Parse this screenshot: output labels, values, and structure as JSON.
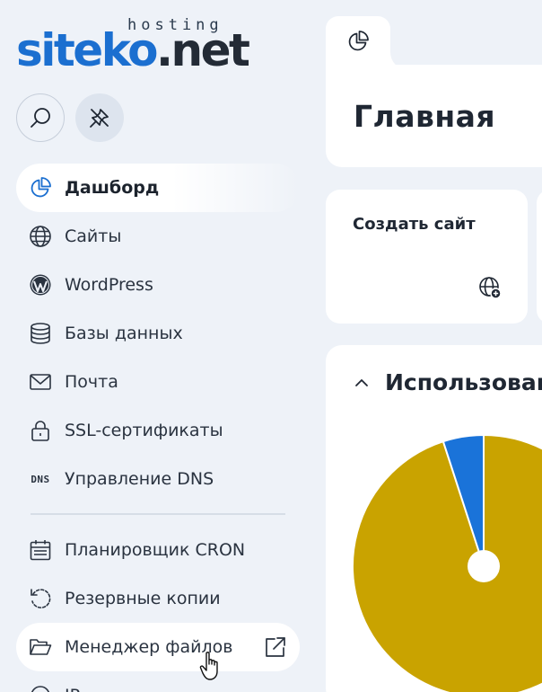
{
  "logo": {
    "brand_blue": "siteko",
    "brand_dark": ".net",
    "tagline": "hosting"
  },
  "toolbar": {
    "search_icon": "search-icon",
    "pin_icon": "unpin-icon"
  },
  "sidebar": {
    "items": [
      {
        "label": "Дашборд",
        "icon": "pie-chart-icon",
        "active": true
      },
      {
        "label": "Сайты",
        "icon": "globe-icon"
      },
      {
        "label": "WordPress",
        "icon": "wordpress-icon"
      },
      {
        "label": "Базы данных",
        "icon": "database-icon"
      },
      {
        "label": "Почта",
        "icon": "mail-icon"
      },
      {
        "label": "SSL-сертификаты",
        "icon": "lock-icon"
      },
      {
        "label": "Управление DNS",
        "icon": "dns-icon",
        "icon_text": "DNS"
      },
      {
        "label": "Планировщик CRON",
        "icon": "calendar-icon"
      },
      {
        "label": "Резервные копии",
        "icon": "backup-icon"
      },
      {
        "label": "Менеджер файлов",
        "icon": "folder-open-icon",
        "external": true
      },
      {
        "label": "IP",
        "icon": "ip-icon"
      }
    ]
  },
  "main": {
    "tab_icon": "pie-chart-icon",
    "page_title": "Главная",
    "actions": [
      {
        "title": "Создать сайт",
        "icon": "globe-add-icon"
      }
    ],
    "usage": {
      "title": "Использование ресурсов"
    }
  },
  "chart_data": {
    "type": "pie",
    "values": [
      95,
      5
    ],
    "colors": [
      "#c9a300",
      "#1a73d9"
    ],
    "donut_hole": true
  },
  "colors": {
    "accent": "#1b6fd0",
    "background": "#eef2f8",
    "card": "#ffffff"
  }
}
